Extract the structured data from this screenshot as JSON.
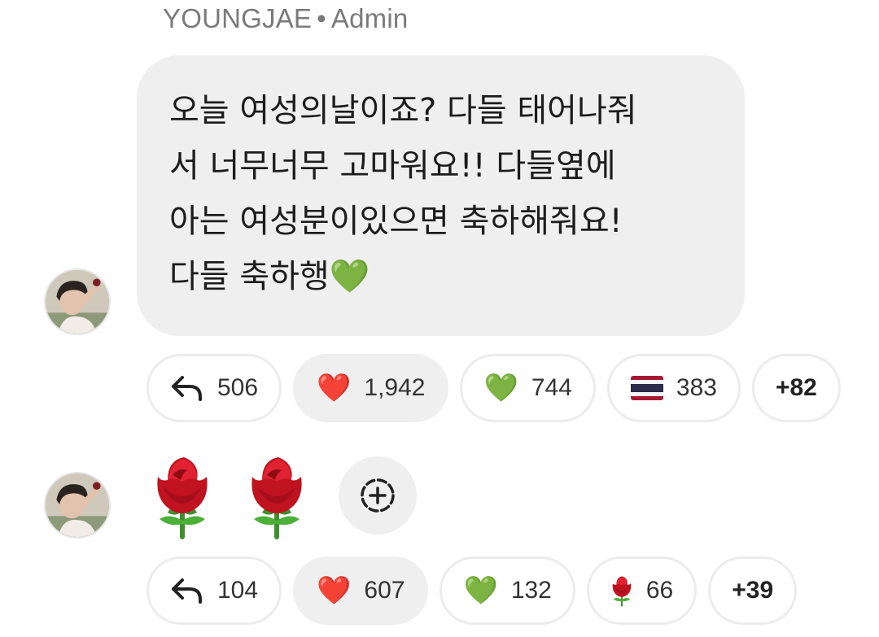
{
  "message": {
    "sender_name": "YOUNGJAE",
    "separator": "•",
    "sender_role": "Admin",
    "text": "오늘 여성의날이죠? 다들 태어나줘\n서 너무너무 고마워요!! 다들옆에\n아는 여성분이있으면 축하해줘요!\n다들 축하행💚",
    "reactions": [
      {
        "icon": "reply-arrow-icon",
        "count": "506"
      },
      {
        "icon": "red-heart-icon",
        "emoji": "❤️",
        "count": "1,942"
      },
      {
        "icon": "green-heart-icon",
        "emoji": "💚",
        "count": "744"
      },
      {
        "icon": "thailand-flag-icon",
        "count": "383"
      },
      {
        "more": "+82"
      }
    ]
  },
  "sticker_message": {
    "stickers": [
      "rose-icon",
      "rose-icon"
    ],
    "add_reaction_icon": "add-reaction-icon",
    "reactions": [
      {
        "icon": "reply-arrow-icon",
        "count": "104"
      },
      {
        "icon": "red-heart-icon",
        "emoji": "❤️",
        "count": "607"
      },
      {
        "icon": "green-heart-icon",
        "emoji": "💚",
        "count": "132"
      },
      {
        "icon": "rose-icon",
        "count": "66"
      },
      {
        "more": "+39"
      }
    ]
  },
  "colors": {
    "bubble_bg": "#efefef",
    "chip_border": "#ececec",
    "sender_text": "#7a7a7a"
  }
}
